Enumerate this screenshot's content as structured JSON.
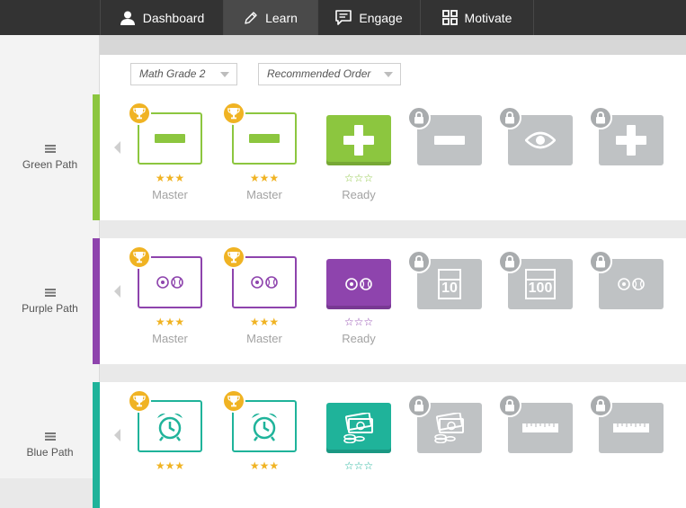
{
  "nav": {
    "tabs": [
      {
        "label": "Dashboard",
        "icon": "person-icon"
      },
      {
        "label": "Learn",
        "icon": "pencil-icon"
      },
      {
        "label": "Engage",
        "icon": "chat-icon"
      },
      {
        "label": "Motivate",
        "icon": "grid-icon"
      }
    ],
    "active": "Learn"
  },
  "filters": {
    "grade": "Math Grade 2",
    "order": "Recommended Order"
  },
  "colors": {
    "green": "#8cc63f",
    "purple": "#8e44ad",
    "teal": "#1fb39a",
    "gold": "#f0b323",
    "locked": "#bfc2c4"
  },
  "paths": [
    {
      "label": "Green Path",
      "color": "#8cc63f",
      "skills": [
        {
          "state": "master",
          "icon": "minus-icon",
          "stars": "★★★",
          "status": "Master"
        },
        {
          "state": "master",
          "icon": "minus-icon",
          "stars": "★★★",
          "status": "Master"
        },
        {
          "state": "ready",
          "icon": "plus-icon",
          "stars": "☆☆☆",
          "status": "Ready"
        },
        {
          "state": "locked",
          "icon": "minus-icon"
        },
        {
          "state": "locked",
          "icon": "eye-icon"
        },
        {
          "state": "locked",
          "icon": "plus-icon"
        }
      ]
    },
    {
      "label": "Purple Path",
      "color": "#8e44ad",
      "skills": [
        {
          "state": "master",
          "icon": "balls-icon",
          "stars": "★★★",
          "status": "Master"
        },
        {
          "state": "master",
          "icon": "balls-icon",
          "stars": "★★★",
          "status": "Master"
        },
        {
          "state": "ready",
          "icon": "balls-icon",
          "stars": "☆☆☆",
          "status": "Ready"
        },
        {
          "state": "locked",
          "icon": "ten-block-icon",
          "text": "10"
        },
        {
          "state": "locked",
          "icon": "hundred-block-icon",
          "text": "100"
        },
        {
          "state": "locked",
          "icon": "balls-icon"
        }
      ]
    },
    {
      "label": "Blue Path",
      "color": "#1fb39a",
      "skills": [
        {
          "state": "master",
          "icon": "alarm-clock-icon",
          "stars": "★★★",
          "status": ""
        },
        {
          "state": "master",
          "icon": "alarm-clock-icon",
          "stars": "★★★",
          "status": ""
        },
        {
          "state": "ready",
          "icon": "money-icon",
          "stars": "☆☆☆",
          "status": ""
        },
        {
          "state": "locked",
          "icon": "money-icon"
        },
        {
          "state": "locked",
          "icon": "ruler-icon"
        },
        {
          "state": "locked",
          "icon": "ruler-icon"
        }
      ]
    }
  ]
}
